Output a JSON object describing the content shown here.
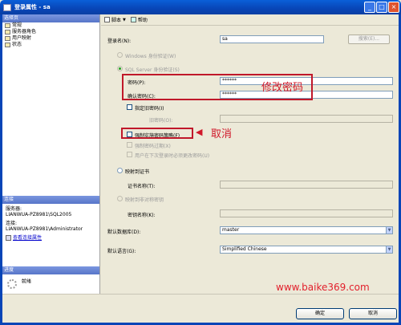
{
  "window": {
    "title": "登录属性 - sa"
  },
  "left": {
    "pages_header": "选择页",
    "pages": [
      {
        "label": "常规"
      },
      {
        "label": "服务器角色"
      },
      {
        "label": "用户映射"
      },
      {
        "label": "状态"
      }
    ],
    "connection_header": "连接",
    "server_label": "服务器:",
    "server_value": "LIANWUA-PZ8981\\SQL2005",
    "connection_label": "连接:",
    "connection_value": "LIANWUA-PZ8981\\Administrator",
    "view_props_link": "查看连接属性",
    "progress_header": "进度",
    "progress_status": "就绪"
  },
  "toolbar": {
    "script_label": "脚本",
    "help_label": "帮助"
  },
  "form": {
    "login_name_label": "登录名(N):",
    "login_name_value": "sa",
    "search_button": "搜索(E)...",
    "windows_auth_label": "Windows 身份验证(W)",
    "sql_auth_label": "SQL Server 身份验证(S)",
    "password_label": "密码(P):",
    "password_value": "******",
    "confirm_label": "确认密码(C):",
    "confirm_value": "******",
    "specify_old_label": "指定旧密码(I)",
    "old_password_label": "旧密码(O):",
    "enforce_policy_label": "强制实施密码策略(F)",
    "enforce_expiration_label": "强制密码过期(X)",
    "must_change_label": "用户在下次登录时必须更改密码(U)",
    "cert_label": "映射到证书",
    "cert_name_label": "证书名称(T):",
    "asym_key_label": "映射到非对称密钥",
    "key_name_label": "密钥名称(K):",
    "default_db_label": "默认数据库(D):",
    "default_db_value": "master",
    "default_lang_label": "默认语言(G):",
    "default_lang_value": "Simplified Chinese"
  },
  "annotations": {
    "change_password": "修改密码",
    "cancel": "取消",
    "arrow": "◀"
  },
  "watermark": "www.baike369.com",
  "buttons": {
    "ok": "确定",
    "cancel": "取消"
  },
  "colors": {
    "title_bar": "#0845b7",
    "annotation_red": "#d0182a"
  }
}
